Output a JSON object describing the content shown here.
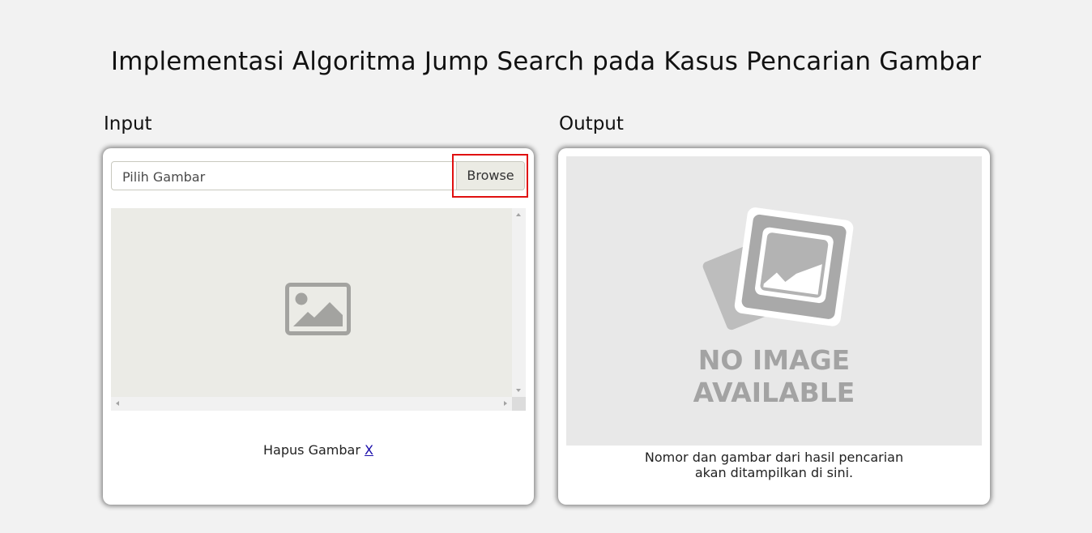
{
  "page": {
    "title": "Implementasi Algoritma Jump Search pada Kasus Pencarian Gambar"
  },
  "input": {
    "label": "Input",
    "file_placeholder": "Pilih Gambar",
    "browse_label": "Browse",
    "delete_text": "Hapus Gambar",
    "delete_link": "X",
    "preview_icon": "image-placeholder-icon"
  },
  "output": {
    "label": "Output",
    "no_image_line1": "NO IMAGE",
    "no_image_line2": "AVAILABLE",
    "caption_line1": "Nomor dan gambar dari hasil pencarian",
    "caption_line2": "akan ditampilkan di sini."
  },
  "colors": {
    "background": "#f2f2f2",
    "card": "#ffffff",
    "highlight": "#e01010",
    "preview_bg": "#ebebe6",
    "link": "#1a0dab"
  }
}
